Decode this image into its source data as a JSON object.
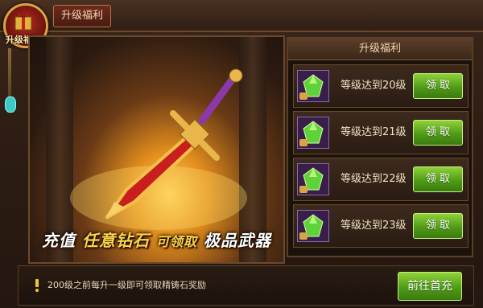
{
  "header": {
    "badge_label": "升级福利",
    "tab_label": "升级福利"
  },
  "banner": {
    "text_part1": "充值",
    "text_part2": "任意钻石",
    "text_part3": "可领取",
    "text_part4": "极品武器"
  },
  "rewards": {
    "title": "升级福利",
    "items": [
      {
        "label": "等级达到20级",
        "button": "领 取"
      },
      {
        "label": "等级达到21级",
        "button": "领 取"
      },
      {
        "label": "等级达到22级",
        "button": "领 取"
      },
      {
        "label": "等级达到23级",
        "button": "领 取"
      }
    ]
  },
  "footer": {
    "notice": "200级之前每升一级即可领取精铸石奖励",
    "goto_button": "前往首充"
  },
  "colors": {
    "claim_green": "#4f9c17",
    "gem_green": "#5fd23a",
    "icon_bg": "#3a1e4a"
  },
  "icons": {
    "reward_icon": "green-gem-icon",
    "lock_icon": "lock-icon",
    "notice_icon": "exclamation-icon"
  }
}
